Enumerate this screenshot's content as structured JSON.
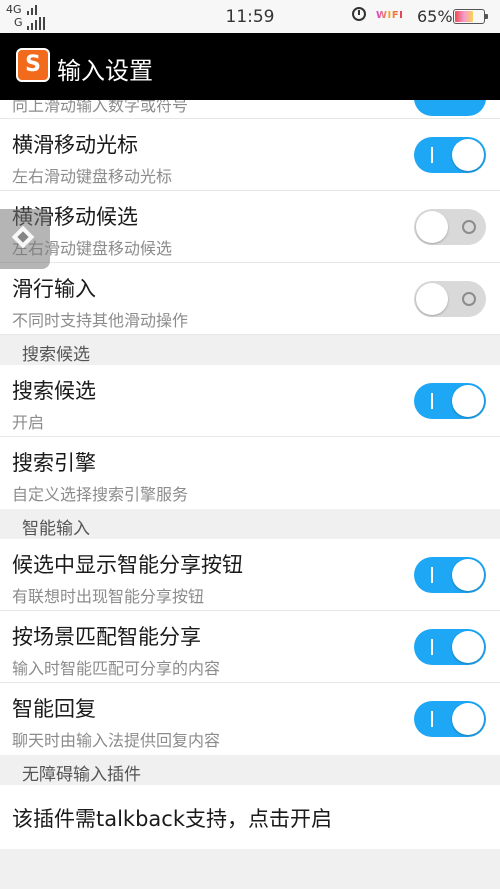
{
  "status_bar": {
    "network_top": "4G",
    "network_bottom": "G",
    "time": "11:59",
    "wifi_label": "WIFI",
    "battery_percent": "65%",
    "battery_level": 0.65,
    "alarm_icon": "alarm-clock-icon"
  },
  "titlebar": {
    "logo_letter": "S",
    "title": "输入设置"
  },
  "partial_row": {
    "subtitle": "向上滑动输入数字或符号",
    "toggle_on": true
  },
  "group1": [
    {
      "title": "横滑移动光标",
      "subtitle": "左右滑动键盘移动光标",
      "toggle_on": true
    },
    {
      "title": "横滑移动候选",
      "subtitle": "左右滑动键盘移动候选",
      "toggle_on": false
    },
    {
      "title": "滑行输入",
      "subtitle": "不同时支持其他滑动操作",
      "toggle_on": false
    }
  ],
  "section_search": "搜索候选",
  "group2": [
    {
      "title": "搜索候选",
      "subtitle": "开启",
      "toggle_on": true
    },
    {
      "title": "搜索引擎",
      "subtitle": "自定义选择搜索引擎服务"
    }
  ],
  "section_smart": "智能输入",
  "group3": [
    {
      "title": "候选中显示智能分享按钮",
      "subtitle": "有联想时出现智能分享按钮",
      "toggle_on": true
    },
    {
      "title": "按场景匹配智能分享",
      "subtitle": "输入时智能匹配可分享的内容",
      "toggle_on": true
    },
    {
      "title": "智能回复",
      "subtitle": "聊天时由输入法提供回复内容",
      "toggle_on": true
    }
  ],
  "section_access": "无障碍输入插件",
  "access_row": {
    "title": "该插件需talkback支持，点击开启"
  }
}
